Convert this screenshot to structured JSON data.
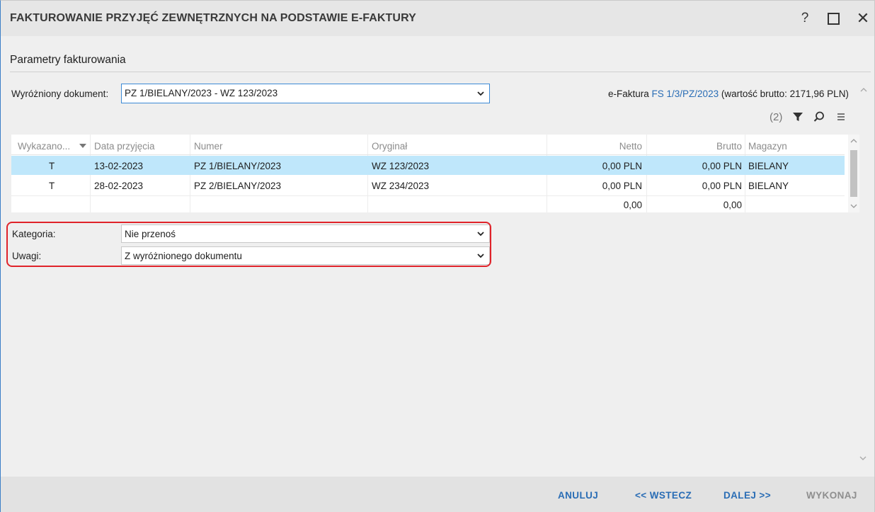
{
  "window": {
    "title": "FAKTUROWANIE PRZYJĘĆ ZEWNĘTRZNYCH NA PODSTAWIE E-FAKTURY",
    "help_label": "?",
    "close_label": "✕"
  },
  "section": {
    "title": "Parametry fakturowania"
  },
  "highlighted_document": {
    "label": "Wyróżniony dokument:",
    "value": "PZ 1/BIELANY/2023 - WZ 123/2023"
  },
  "efaktura": {
    "prefix": "e-Faktura ",
    "link": "FS 1/3/PZ/2023",
    "suffix": " (wartość brutto: 2171,96 PLN)"
  },
  "toolbar": {
    "count": "(2)",
    "icons": [
      "filter-icon",
      "search-icon",
      "menu-icon"
    ]
  },
  "table": {
    "headers": {
      "shown": "Wykazano...",
      "date": "Data przyjęcia",
      "number": "Numer",
      "original": "Oryginał",
      "net": "Netto",
      "gross": "Brutto",
      "warehouse": "Magazyn"
    },
    "rows": [
      {
        "shown": "T",
        "date": "13-02-2023",
        "number": "PZ 1/BIELANY/2023",
        "original": "WZ 123/2023",
        "net": "0,00 PLN",
        "gross": "0,00 PLN",
        "warehouse": "BIELANY"
      },
      {
        "shown": "T",
        "date": "28-02-2023",
        "number": "PZ 2/BIELANY/2023",
        "original": "WZ 234/2023",
        "net": "0,00 PLN",
        "gross": "0,00 PLN",
        "warehouse": "BIELANY"
      }
    ],
    "totals": {
      "net": "0,00",
      "gross": "0,00"
    }
  },
  "fields": {
    "category": {
      "label": "Kategoria:",
      "value": "Nie przenoś"
    },
    "notes": {
      "label": "Uwagi:",
      "value": "Z wyróżnionego dokumentu"
    }
  },
  "footer": {
    "cancel": "ANULUJ",
    "back": "<< WSTECZ",
    "next": "DALEJ >>",
    "execute": "WYKONAJ"
  },
  "colors": {
    "accent": "#2a6db5",
    "selected_row": "#bfe7fb",
    "highlight_border": "#e0232a"
  }
}
